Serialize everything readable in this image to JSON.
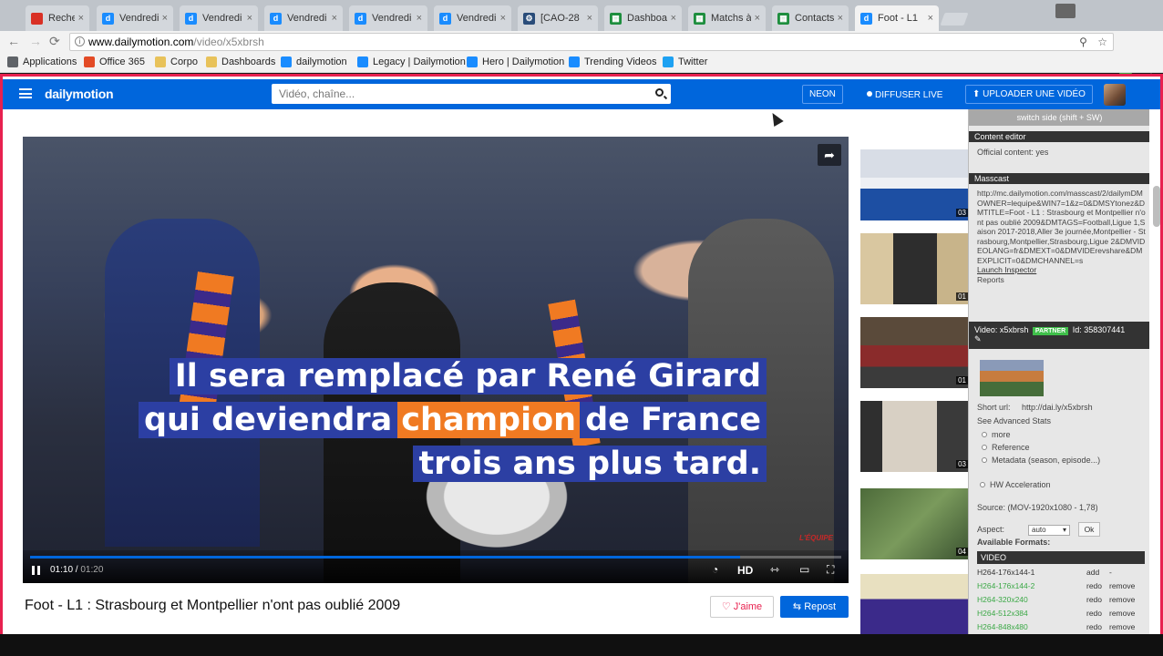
{
  "browser": {
    "tabs": [
      {
        "label": "Recherch",
        "icon": "red",
        "active": false
      },
      {
        "label": "Vendredi",
        "icon": "dm",
        "active": false
      },
      {
        "label": "Vendredi",
        "icon": "dm",
        "active": false
      },
      {
        "label": "Vendredi",
        "icon": "dm",
        "active": false
      },
      {
        "label": "Vendredi",
        "icon": "dm",
        "active": false
      },
      {
        "label": "Vendredi",
        "icon": "dm",
        "active": false
      },
      {
        "label": "[CAO-28",
        "icon": "jira",
        "active": false
      },
      {
        "label": "Dashboa",
        "icon": "sheets",
        "active": false
      },
      {
        "label": "Matchs à",
        "icon": "sheets",
        "active": false
      },
      {
        "label": "Contacts",
        "icon": "sheets",
        "active": false
      },
      {
        "label": "Foot - L1",
        "icon": "dm",
        "active": true
      }
    ],
    "url_host": "www.dailymotion.com",
    "url_path": "/video/x5xbrsh",
    "bookmarks": [
      {
        "label": "Applications",
        "icon": "apps"
      },
      {
        "label": "Office 365",
        "icon": "office"
      },
      {
        "label": "Corpo",
        "icon": "folder"
      },
      {
        "label": "Dashboards",
        "icon": "folder"
      },
      {
        "label": "dailymotion",
        "icon": "dm"
      },
      {
        "label": "Legacy | Dailymotion",
        "icon": "dm"
      },
      {
        "label": "Hero | Dailymotion",
        "icon": "dm"
      },
      {
        "label": "Trending Videos",
        "icon": "dm"
      },
      {
        "label": "Twitter",
        "icon": "twitter"
      }
    ]
  },
  "header": {
    "logo": "dailymotion",
    "search_placeholder": "Vidéo, chaîne...",
    "neon": "NEON",
    "live": "DIFFUSER LIVE",
    "upload": "⬆ UPLOADER UNE VIDÉO"
  },
  "player": {
    "subtitle_line1": "Il sera remplacé par René Girard",
    "subtitle_line2_pre": "qui deviendra",
    "subtitle_line2_hl": "champion",
    "subtitle_line2_post": "de France",
    "subtitle_line3": "trois ans plus tard.",
    "watermark": "L'ÉQUIPE",
    "current_time": "01:10",
    "duration": "01:20",
    "progress": 0.875,
    "quality": "HD"
  },
  "video": {
    "title": "Foot - L1 : Strasbourg et Montpellier n'ont pas oublié 2009",
    "like_label": "♡ J'aime",
    "repost_label": "⇆ Repost"
  },
  "related": [
    {
      "duration": "03"
    },
    {
      "duration": "01"
    },
    {
      "duration": "01"
    },
    {
      "duration": "03"
    },
    {
      "duration": "04"
    },
    {
      "duration": ""
    }
  ],
  "sidepanel": {
    "switch_label": "switch side (shift + SW)",
    "content_editor": "Content editor",
    "official": "Official content: yes",
    "masscast_head": "Masscast",
    "masscast_url": "http://mc.dailymotion.com/masscast/2/dailymDMOWNER=lequipe&WIN7=1&z=0&DMSYtonez&DMTITLE=Foot - L1 : Strasbourg et Montpellier n'ont pas oublié 2009&DMTAGS=Football,Ligue 1,Saison 2017-2018,Aller 3e journée,Montpellier - Strasbourg,Montpellier,Strasbourg,Ligue 2&DMVIDEOLANG=fr&DMEXT=0&DMVIDErevshare&DMEXPLICIT=0&DMCHANNEL=s",
    "launch_inspector": "Launch Inspector",
    "reports": "Reports",
    "video_id": "Video: x5xbrsh",
    "partner": "PARTNER",
    "numeric_id": "Id: 358307441",
    "short_url_label": "Short url:",
    "short_url": "http://dai.ly/x5xbrsh",
    "advanced_stats": "See Advanced Stats",
    "opt_more": "more",
    "opt_reference": "Reference",
    "opt_metadata": "Metadata (season, episode...)",
    "hw_accel": "HW Acceleration",
    "source": "Source: (MOV-1920x1080 - 1,78)",
    "aspect_label": "Aspect:",
    "aspect_value": "auto",
    "ok": "Ok",
    "available_formats": "Available Formats:",
    "video_head": "VIDEO",
    "formats": [
      {
        "name": "H264-176x144-1",
        "a1": "add",
        "a2": "-",
        "green": false
      },
      {
        "name": "H264-176x144-2",
        "a1": "redo",
        "a2": "remove",
        "green": true
      },
      {
        "name": "H264-320x240",
        "a1": "redo",
        "a2": "remove",
        "green": true
      },
      {
        "name": "H264-512x384",
        "a1": "redo",
        "a2": "remove",
        "green": true
      },
      {
        "name": "H264-848x480",
        "a1": "redo",
        "a2": "remove",
        "green": true
      }
    ]
  },
  "colors": {
    "brand": "#0066dc",
    "accent_border": "#e8214f",
    "subtitle_bg": "#2c3fa3",
    "subtitle_highlight": "#f07a22",
    "partner": "#3fbf4a"
  }
}
